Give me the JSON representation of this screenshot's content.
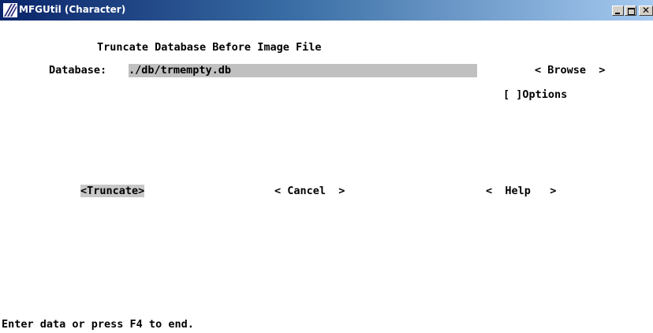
{
  "window": {
    "title": "MFGUtil (Character)",
    "controls": {
      "minimize": "_",
      "maximize": "□",
      "close": "×"
    }
  },
  "form": {
    "heading": "Truncate Database Before Image File",
    "database_label": "Database:",
    "database_value": "./db/trmempty.db",
    "browse_button": "< Browse  >",
    "options_checkbox": "[ ]Options"
  },
  "buttons": {
    "truncate": "<Truncate>",
    "cancel": "< Cancel  >",
    "help": "<  Help   >"
  },
  "status_bar": {
    "message": "Enter data or press F4 to end."
  },
  "colors": {
    "titlebar_start": "#0a246a",
    "titlebar_end": "#a6caf0",
    "field_background": "#c0c0c0",
    "focused_button_background": "#c8c8c8"
  }
}
